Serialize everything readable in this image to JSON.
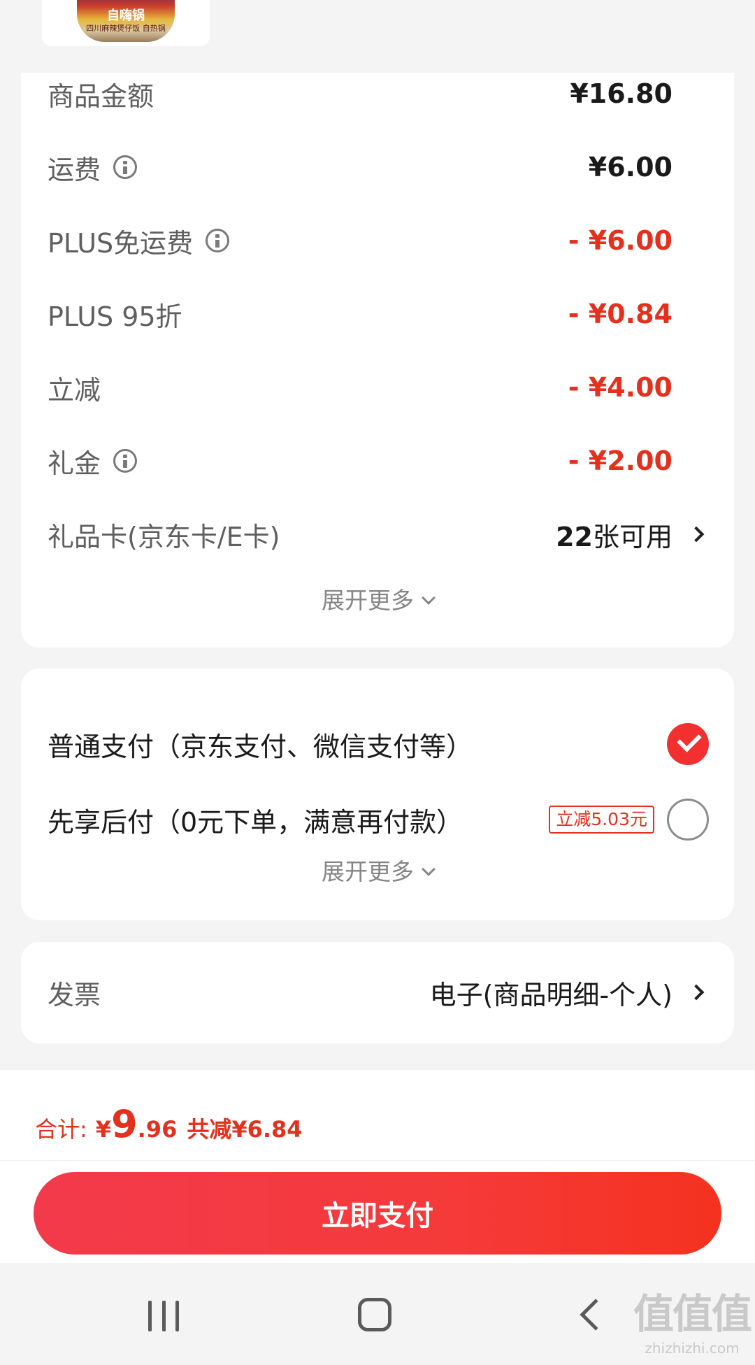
{
  "product": {
    "brand": "自嗨锅",
    "subtitle": "四川麻辣煲仔饭 自热锅"
  },
  "summary": {
    "rows": [
      {
        "label": "商品金额",
        "amount": "¥16.80",
        "info": false,
        "red": false
      },
      {
        "label": "运费",
        "amount": "¥6.00",
        "info": true,
        "red": false
      },
      {
        "label": "PLUS免运费",
        "amount": "- ¥6.00",
        "info": true,
        "red": true
      },
      {
        "label": "PLUS 95折",
        "amount": "- ¥0.84",
        "info": false,
        "red": true
      },
      {
        "label": "立减",
        "amount": "- ¥4.00",
        "info": false,
        "red": true
      },
      {
        "label": "礼金",
        "amount": "- ¥2.00",
        "info": true,
        "red": true
      }
    ],
    "giftcard": {
      "label": "礼品卡(京东卡/E卡)",
      "count": "22",
      "suffix": "张可用"
    },
    "expand": "展开更多"
  },
  "payment": {
    "options": [
      {
        "label": "普通支付（京东支付、微信支付等）",
        "selected": true
      },
      {
        "label": "先享后付（0元下单，满意再付款）",
        "selected": false,
        "tag": "立减5.03元"
      }
    ],
    "expand": "展开更多"
  },
  "invoice": {
    "label": "发票",
    "value": "电子(商品明细-个人)"
  },
  "total": {
    "label": "合计:",
    "currency": "¥",
    "integer": "9",
    "decimal": ".96",
    "saved": "共减¥6.84"
  },
  "pay_button": "立即支付",
  "watermark": {
    "main": "值值值",
    "sub": "zhizhizhi.com"
  },
  "colors": {
    "accent_red": "#e4311e",
    "button_red": "#f23a4b"
  },
  "icons": [
    "info-icon",
    "chevron-right-icon",
    "chevron-down-icon",
    "check-icon",
    "recents-icon",
    "home-icon",
    "back-icon"
  ]
}
